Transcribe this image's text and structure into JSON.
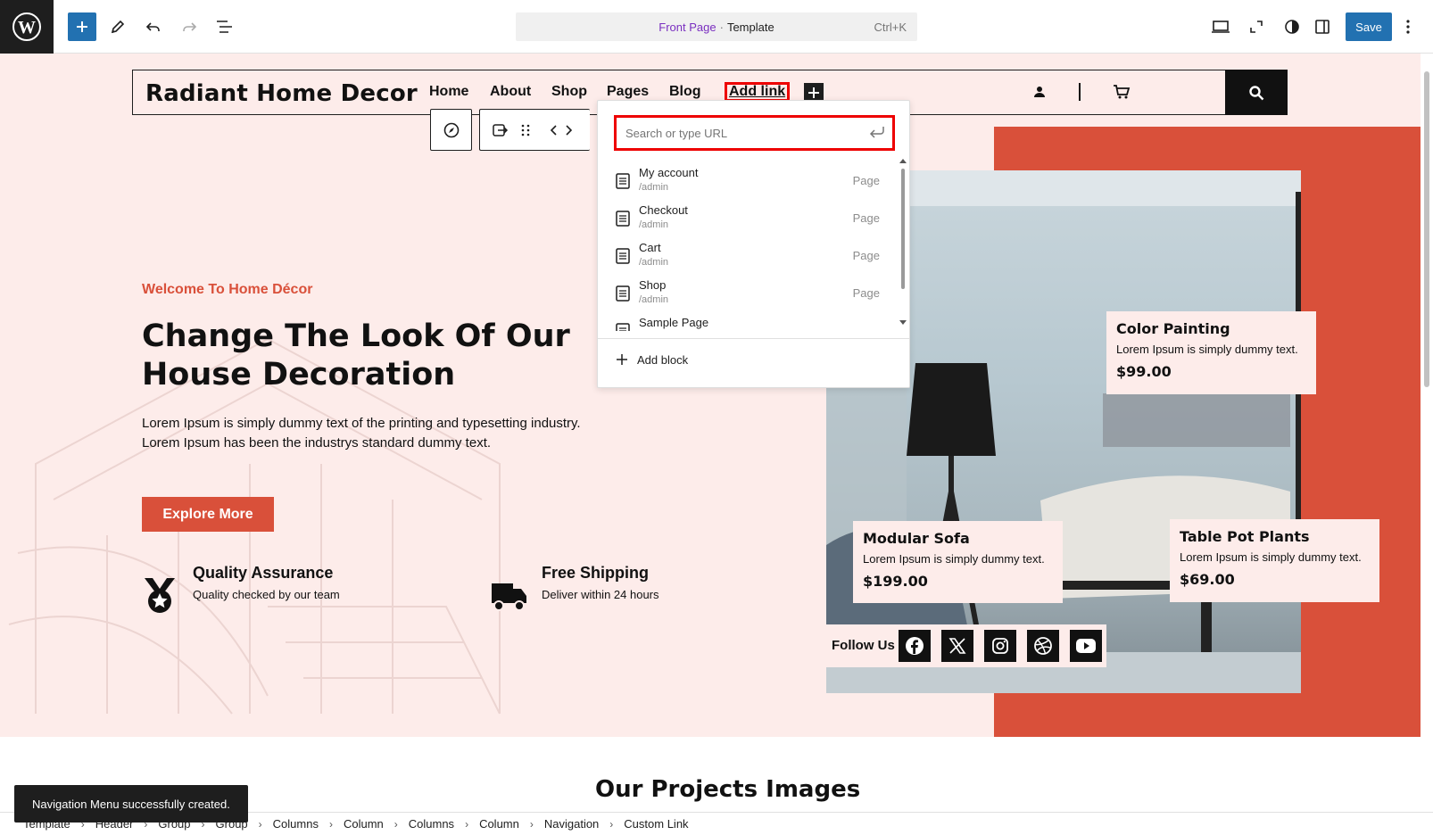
{
  "toolbar": {
    "command_title": "Front Page",
    "command_sep": "·",
    "command_type": "Template",
    "command_shortcut": "Ctrl+K",
    "save_label": "Save"
  },
  "header": {
    "site_title": "Radiant Home Decor",
    "nav": [
      "Home",
      "About",
      "Shop",
      "Pages",
      "Blog"
    ],
    "add_link_label": "Add link"
  },
  "link_popover": {
    "placeholder": "Search or type URL",
    "suggestions": [
      {
        "name": "My account",
        "path": "/admin",
        "type": "Page"
      },
      {
        "name": "Checkout",
        "path": "/admin",
        "type": "Page"
      },
      {
        "name": "Cart",
        "path": "/admin",
        "type": "Page"
      },
      {
        "name": "Shop",
        "path": "/admin",
        "type": "Page"
      },
      {
        "name": "Sample Page",
        "path": "",
        "type": ""
      }
    ],
    "add_block_label": "Add block"
  },
  "hero": {
    "eyebrow": "Welcome To Home Décor",
    "title": "Change The Look Of Our House Decoration",
    "desc_line1": "Lorem Ipsum is simply dummy text of the printing and typesetting industry.",
    "desc_line2": "Lorem Ipsum has been the industrys standard dummy text.",
    "button": "Explore More",
    "features": [
      {
        "title": "Quality Assurance",
        "sub": "Quality checked by our team"
      },
      {
        "title": "Free Shipping",
        "sub": "Deliver within 24 hours"
      }
    ]
  },
  "products": [
    {
      "title": "Color Painting",
      "desc": "Lorem Ipsum is simply dummy text.",
      "price": "$99.00"
    },
    {
      "title": "Modular Sofa",
      "desc": "Lorem Ipsum is simply dummy text.",
      "price": "$199.00"
    },
    {
      "title": "Table Pot Plants",
      "desc": "Lorem Ipsum is simply dummy text.",
      "price": "$69.00"
    }
  ],
  "follow": {
    "label": "Follow Us",
    "icons": [
      "facebook-icon",
      "x-icon",
      "instagram-icon",
      "dribbble-icon",
      "youtube-icon"
    ]
  },
  "section2": {
    "title": "Our Projects Images"
  },
  "snackbar": "Navigation Menu successfully created.",
  "breadcrumb": [
    "Template",
    "Header",
    "Group",
    "Group",
    "Columns",
    "Column",
    "Columns",
    "Column",
    "Navigation",
    "Custom Link"
  ],
  "colors": {
    "accent": "#d9503a",
    "canvas_bg": "#fdecea",
    "wp_blue": "#2271b1",
    "highlight": "#ee0000"
  }
}
